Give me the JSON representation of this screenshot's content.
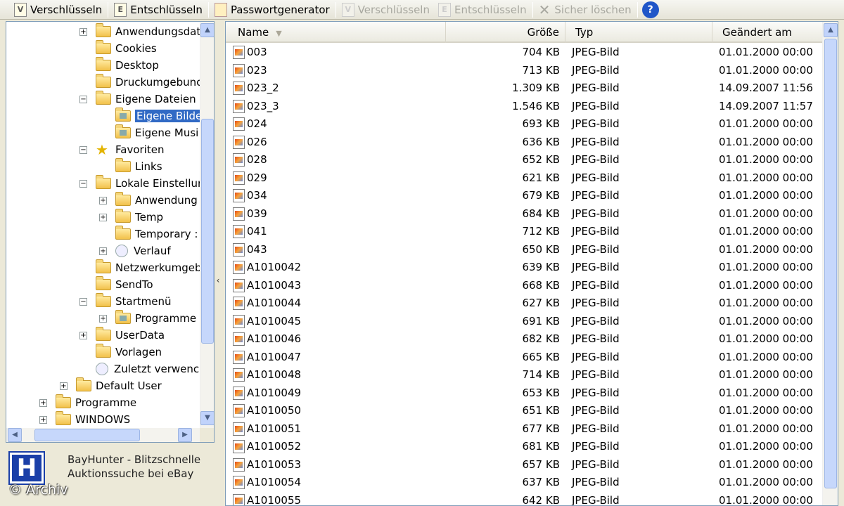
{
  "toolbar": {
    "encrypt": "Verschlüsseln",
    "decrypt": "Entschlüsseln",
    "password_generator": "Passwortgenerator",
    "encrypt_disabled": "Verschlüsseln",
    "decrypt_disabled": "Entschlüsseln",
    "secure_delete": "Sicher löschen",
    "encrypt_icon": "V",
    "decrypt_icon": "E",
    "help_icon": "?"
  },
  "tree": {
    "items": [
      {
        "label": "Anwendungsdat",
        "expander": "+"
      },
      {
        "label": "Cookies"
      },
      {
        "label": "Desktop"
      },
      {
        "label": "Druckumgebunc"
      },
      {
        "label": "Eigene Dateien",
        "expander": "−"
      },
      {
        "label": "Eigene Bilde",
        "selected": true
      },
      {
        "label": "Eigene Musi"
      },
      {
        "label": "Favoriten",
        "expander": "−"
      },
      {
        "label": "Links"
      },
      {
        "label": "Lokale Einstellur",
        "expander": "−"
      },
      {
        "label": "Anwendung",
        "expander": "+"
      },
      {
        "label": "Temp",
        "expander": "+"
      },
      {
        "label": "Temporary :"
      },
      {
        "label": "Verlauf",
        "expander": "+"
      },
      {
        "label": "Netzwerkumgeb"
      },
      {
        "label": "SendTo"
      },
      {
        "label": "Startmenü",
        "expander": "−"
      },
      {
        "label": "Programme",
        "expander": "+"
      },
      {
        "label": "UserData",
        "expander": "+"
      },
      {
        "label": "Vorlagen"
      },
      {
        "label": "Zuletzt verwenc"
      },
      {
        "label": "Default User",
        "expander": "+"
      },
      {
        "label": "Programme",
        "expander": "+"
      },
      {
        "label": "WINDOWS",
        "expander": "+"
      }
    ]
  },
  "banner": {
    "logo_letter": "H",
    "line1": "BayHunter - Blitzschnelle",
    "line2": "Auktionssuche bei eBay"
  },
  "watermark": "© Archiv",
  "columns": {
    "name": "Name",
    "size": "Größe",
    "type": "Typ",
    "modified": "Geändert am"
  },
  "files": [
    {
      "name": "003",
      "size": "704 KB",
      "type": "JPEG-Bild",
      "modified": "01.01.2000 00:00"
    },
    {
      "name": "023",
      "size": "713 KB",
      "type": "JPEG-Bild",
      "modified": "01.01.2000 00:00"
    },
    {
      "name": "023_2",
      "size": "1.309 KB",
      "type": "JPEG-Bild",
      "modified": "14.09.2007 11:56"
    },
    {
      "name": "023_3",
      "size": "1.546 KB",
      "type": "JPEG-Bild",
      "modified": "14.09.2007 11:57"
    },
    {
      "name": "024",
      "size": "693 KB",
      "type": "JPEG-Bild",
      "modified": "01.01.2000 00:00"
    },
    {
      "name": "026",
      "size": "636 KB",
      "type": "JPEG-Bild",
      "modified": "01.01.2000 00:00"
    },
    {
      "name": "028",
      "size": "652 KB",
      "type": "JPEG-Bild",
      "modified": "01.01.2000 00:00"
    },
    {
      "name": "029",
      "size": "621 KB",
      "type": "JPEG-Bild",
      "modified": "01.01.2000 00:00"
    },
    {
      "name": "034",
      "size": "679 KB",
      "type": "JPEG-Bild",
      "modified": "01.01.2000 00:00"
    },
    {
      "name": "039",
      "size": "684 KB",
      "type": "JPEG-Bild",
      "modified": "01.01.2000 00:00"
    },
    {
      "name": "041",
      "size": "712 KB",
      "type": "JPEG-Bild",
      "modified": "01.01.2000 00:00"
    },
    {
      "name": "043",
      "size": "650 KB",
      "type": "JPEG-Bild",
      "modified": "01.01.2000 00:00"
    },
    {
      "name": "A1010042",
      "size": "639 KB",
      "type": "JPEG-Bild",
      "modified": "01.01.2000 00:00"
    },
    {
      "name": "A1010043",
      "size": "668 KB",
      "type": "JPEG-Bild",
      "modified": "01.01.2000 00:00"
    },
    {
      "name": "A1010044",
      "size": "627 KB",
      "type": "JPEG-Bild",
      "modified": "01.01.2000 00:00"
    },
    {
      "name": "A1010045",
      "size": "691 KB",
      "type": "JPEG-Bild",
      "modified": "01.01.2000 00:00"
    },
    {
      "name": "A1010046",
      "size": "682 KB",
      "type": "JPEG-Bild",
      "modified": "01.01.2000 00:00"
    },
    {
      "name": "A1010047",
      "size": "665 KB",
      "type": "JPEG-Bild",
      "modified": "01.01.2000 00:00"
    },
    {
      "name": "A1010048",
      "size": "714 KB",
      "type": "JPEG-Bild",
      "modified": "01.01.2000 00:00"
    },
    {
      "name": "A1010049",
      "size": "653 KB",
      "type": "JPEG-Bild",
      "modified": "01.01.2000 00:00"
    },
    {
      "name": "A1010050",
      "size": "651 KB",
      "type": "JPEG-Bild",
      "modified": "01.01.2000 00:00"
    },
    {
      "name": "A1010051",
      "size": "677 KB",
      "type": "JPEG-Bild",
      "modified": "01.01.2000 00:00"
    },
    {
      "name": "A1010052",
      "size": "681 KB",
      "type": "JPEG-Bild",
      "modified": "01.01.2000 00:00"
    },
    {
      "name": "A1010053",
      "size": "657 KB",
      "type": "JPEG-Bild",
      "modified": "01.01.2000 00:00"
    },
    {
      "name": "A1010054",
      "size": "637 KB",
      "type": "JPEG-Bild",
      "modified": "01.01.2000 00:00"
    },
    {
      "name": "A1010055",
      "size": "642 KB",
      "type": "JPEG-Bild",
      "modified": "01.01.2000 00:00"
    }
  ]
}
